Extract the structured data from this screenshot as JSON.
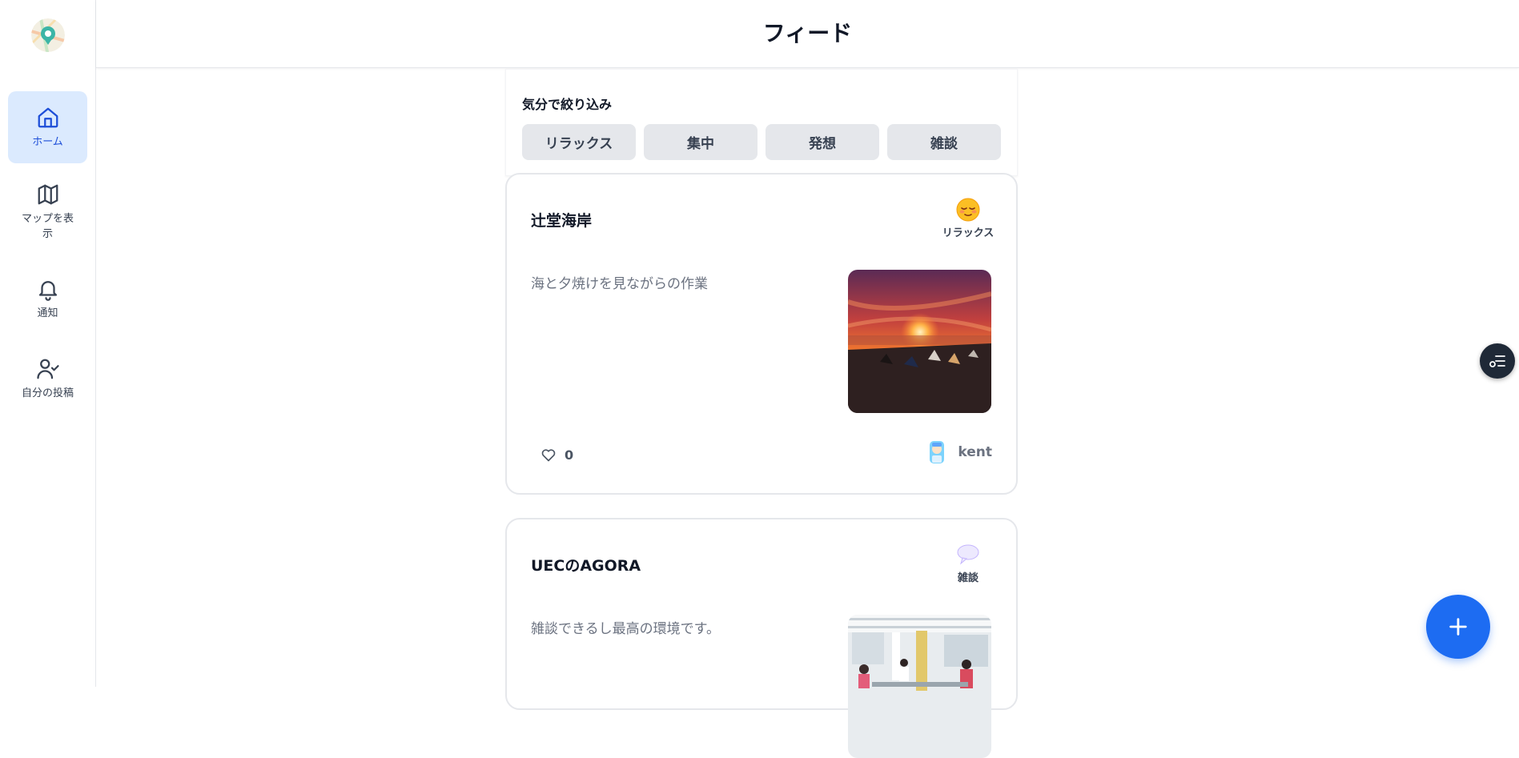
{
  "app": {
    "title": "フィード"
  },
  "sidebar": {
    "items": [
      {
        "label": "ホーム",
        "icon": "home-icon",
        "active": true
      },
      {
        "label": "マップを表示",
        "icon": "map-icon",
        "active": false
      },
      {
        "label": "通知",
        "icon": "bell-icon",
        "active": false
      },
      {
        "label": "自分の投稿",
        "icon": "user-check-icon",
        "active": false
      }
    ]
  },
  "filter": {
    "title": "気分で絞り込み",
    "options": [
      "リラックス",
      "集中",
      "発想",
      "雑談"
    ]
  },
  "posts": [
    {
      "title": "辻堂海岸",
      "mood_label": "リラックス",
      "mood_icon": "relieved-face-icon",
      "description": "海と夕焼けを見ながらの作業",
      "likes": "0",
      "author": "kent"
    },
    {
      "title": "UECのAGORA",
      "mood_label": "雑談",
      "mood_icon": "speech-bubble-icon",
      "description": "雑談できるし最高の環境です。"
    }
  ],
  "colors": {
    "accent": "#1d6cf2",
    "active_nav_bg": "#dbeafe",
    "chip_bg": "#e5e7eb"
  }
}
